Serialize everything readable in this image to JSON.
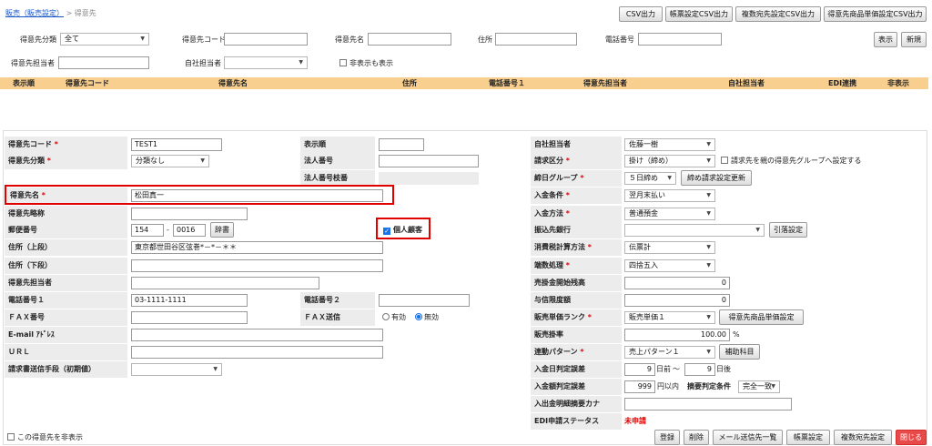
{
  "breadcrumb": {
    "parent": "販売（販売設定）",
    "separator": ">",
    "current": "得意先"
  },
  "top_buttons": [
    "CSV出力",
    "帳票設定CSV出力",
    "複数宛先設定CSV出力",
    "得意先商品単価設定CSV出力"
  ],
  "search": {
    "category_label": "得意先分類",
    "category_value": "全て",
    "code_label": "得意先コード",
    "code_value": "",
    "name_label": "得意先名",
    "name_value": "",
    "address_label": "住所",
    "address_value": "",
    "phone_label": "電話番号",
    "phone_value": "",
    "display_button": "表示",
    "new_button": "新規",
    "rep_label": "得意先担当者",
    "rep_value": "",
    "own_rep_label": "自社担当者",
    "own_rep_value": "",
    "show_hidden_label": "非表示も表示"
  },
  "table_headers": [
    "表示順",
    "得意先コード",
    "得意先名",
    "住所",
    "電話番号１",
    "得意先担当者",
    "自社担当者",
    "EDI連携",
    "非表示"
  ],
  "form": {
    "code_label": "得意先コード",
    "code_value": "TEST1",
    "category_label": "得意先分類",
    "category_value": "分類なし",
    "name_label": "得意先名",
    "name_value": "松田真一",
    "short_label": "得意先略称",
    "short_value": "",
    "zip_label": "郵便番号",
    "zip1": "154",
    "zip_sep": "-",
    "zip2": "0016",
    "dict_button": "辞書",
    "addr1_label": "住所（上段）",
    "addr1_value": "東京都世田谷区弦巻*－*－＊＊",
    "addr2_label": "住所（下段）",
    "addr2_value": "",
    "contact_label": "得意先担当者",
    "contact_value": "",
    "phone1_label": "電話番号１",
    "phone1_value": "03-1111-1111",
    "fax_label": "ＦＡＸ番号",
    "fax_value": "",
    "email_label": "E-mail ｱﾄﾞﾚｽ",
    "email_value": "",
    "url_label": "ＵＲＬ",
    "url_value": "",
    "invoice_label": "請求書送信手段（初期値）",
    "invoice_value": "",
    "order_label": "表示順",
    "order_value": "",
    "corp_label": "法人番号",
    "corp_value": "",
    "corp_branch_label": "法人番号枝番",
    "corp_branch_value": "",
    "individual_label": "個人顧客",
    "phone2_label": "電話番号２",
    "phone2_value": "",
    "faxsend_label": "ＦＡＸ送信",
    "faxsend_on": "有効",
    "faxsend_off": "無効",
    "own_rep_label": "自社担当者",
    "own_rep_value": "佐藤一樹",
    "billing_label": "請求区分",
    "billing_value": "掛け（締め）",
    "parent_group_label": "請求先を親の得意先グループへ設定する",
    "closing_label": "締日グループ",
    "closing_value": "５日締め",
    "closing_button": "締め請求設定更新",
    "payment_cond_label": "入金条件",
    "payment_cond_value": "翌月末払い",
    "payment_method_label": "入金方法",
    "payment_method_value": "普通預金",
    "bank_label": "振込先銀行",
    "bank_value": "",
    "bank_button": "引落設定",
    "tax_label": "消費税計算方法",
    "tax_value": "伝票計",
    "rounding_label": "端数処理",
    "rounding_value": "四捨五入",
    "opening_label": "売掛金開始残高",
    "opening_value": "0",
    "credit_label": "与信限度額",
    "credit_value": "0",
    "price_rank_label": "販売単価ランク",
    "price_rank_value": "販売単価１",
    "price_rank_button": "得意先商品単価設定",
    "rate_label": "販売掛率",
    "rate_value": "100.00",
    "rate_unit": "%",
    "pattern_label": "連動パターン",
    "pattern_value": "売上パターン１",
    "pattern_button": "補助科目",
    "date_diff_label": "入金日判定誤差",
    "date_before": "9",
    "date_before_unit": "日前",
    "date_tilde": "～",
    "date_after": "9",
    "date_after_unit": "日後",
    "amount_diff_label": "入金額判定誤差",
    "amount_value": "999",
    "amount_unit": "円以内",
    "match_label": "摘要判定条件",
    "match_value": "完全一致",
    "summary_label": "入出金明細摘要カナ",
    "summary_value": "",
    "edi_label": "EDI申請ステータス",
    "edi_value": "未申請",
    "hide_label": "この得意先を非表示"
  },
  "bottom_buttons": [
    "登録",
    "削除",
    "メール送信先一覧",
    "帳票設定",
    "複数宛先設定",
    "閉じる"
  ],
  "colors": {
    "header_bg": "#f9cf8f",
    "required": "#e00000",
    "highlight": "#e00000",
    "close_bg": "#e84a4a",
    "checkbox": "#1a73e8"
  }
}
